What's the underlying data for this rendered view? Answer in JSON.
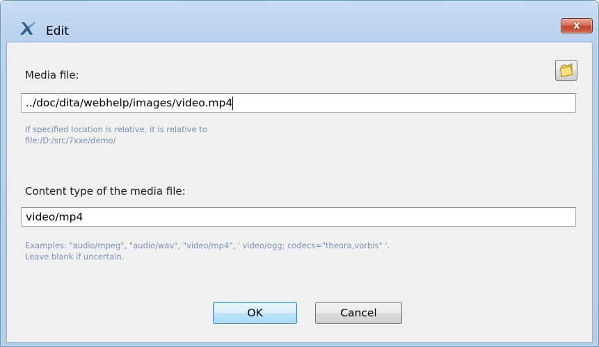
{
  "window": {
    "title": "Edit",
    "close_label": "x"
  },
  "media": {
    "label": "Media file:",
    "value": "../doc/dita/webhelp/images/video.mp4",
    "hint_line1": "If specified location is relative, it is relative to",
    "hint_line2": "file:/D:/src/7xxe/demo/"
  },
  "content_type": {
    "label": "Content type of the media file:",
    "value": "video/mp4",
    "hint_line1": "Examples: \"audio/mpeg\", \"audio/wav\", \"video/mp4\", ' video/ogg; codecs=\"theora,vorbis\" '.",
    "hint_line2": "Leave blank if uncertain."
  },
  "buttons": {
    "ok": "OK",
    "cancel": "Cancel"
  },
  "icons": {
    "app": "app-logo-icon",
    "browse": "folder-icon",
    "close": "close-icon"
  }
}
